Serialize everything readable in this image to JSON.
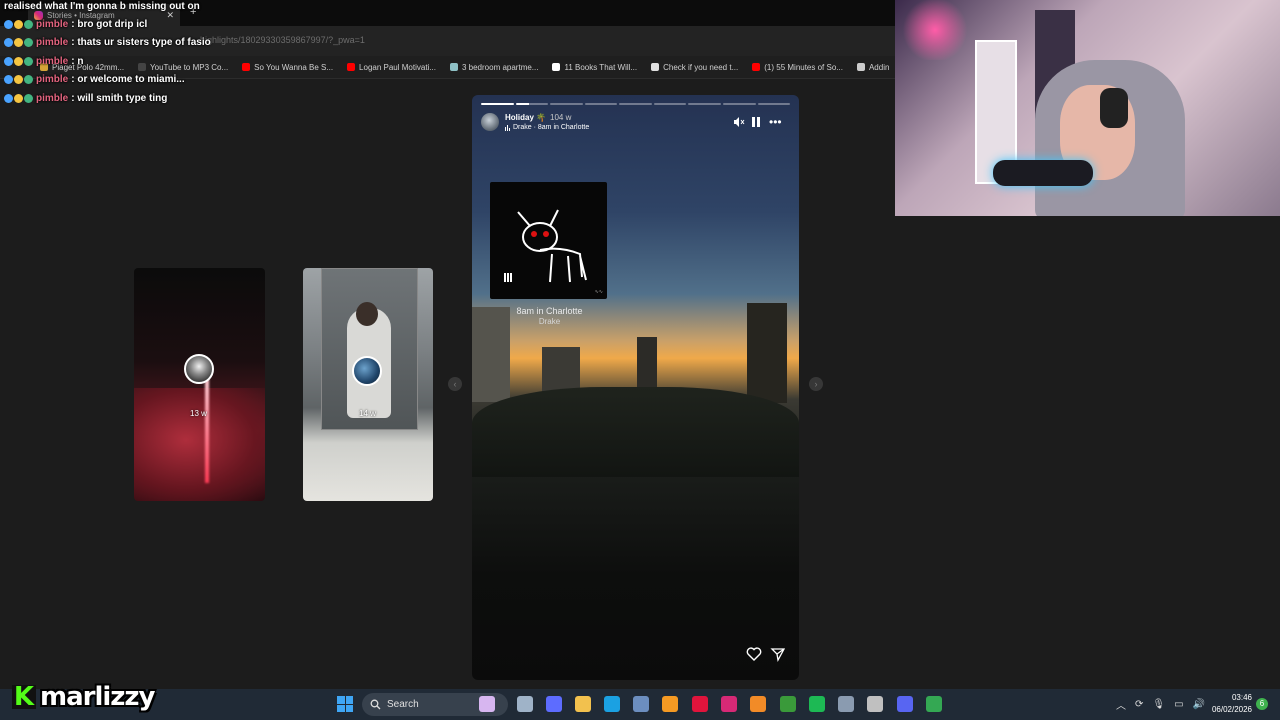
{
  "browser": {
    "tab_title": "Stories • Instagram",
    "url_fragment": "highlights/18029330359867997/?_pwa=1",
    "bookmarks": [
      {
        "label": "Piaget Polo 42mm...",
        "color": "#d6a437"
      },
      {
        "label": "YouTube to MP3 Co...",
        "color": "#444444"
      },
      {
        "label": "So You Wanna Be S...",
        "color": "#ff0000"
      },
      {
        "label": "Logan Paul Motivati...",
        "color": "#ff0000"
      },
      {
        "label": "3 bedroom apartme...",
        "color": "#8fc1c6"
      },
      {
        "label": "11 Books That Will...",
        "color": "#ffffff"
      },
      {
        "label": "Check if you need t...",
        "color": "#e0e0e0"
      },
      {
        "label": "(1) 55 Minutes of So...",
        "color": "#ff0000"
      },
      {
        "label": "Addin",
        "color": "#cccccc"
      }
    ]
  },
  "chat": {
    "first_line": "realised what I'm gonna b missing out on",
    "messages": [
      {
        "user": "pimble",
        "text": ": bro got drip icl"
      },
      {
        "user": "pimble",
        "text": ": thats ur sisters type of fasio"
      },
      {
        "user": "pimble",
        "text": ": n"
      },
      {
        "user": "pimble",
        "text": ": or welcome to miami..."
      },
      {
        "user": "pimble",
        "text": ": will smith type ting"
      }
    ]
  },
  "story": {
    "username": "Holiday 🌴",
    "age": "104 w",
    "song_line": "Drake · 8am in Charlotte",
    "progress_segments": 9,
    "progress_done": 1,
    "card_title": "8am in Charlotte",
    "card_artist": "Drake"
  },
  "side_stories": [
    {
      "time": "13 w"
    },
    {
      "time": "14 w"
    }
  ],
  "streamer": {
    "logo_letter": "K",
    "name": "marlizzy"
  },
  "taskbar": {
    "search_label": "Search",
    "time": "03:46",
    "date": "06/02/2026",
    "notification_count": "6"
  }
}
